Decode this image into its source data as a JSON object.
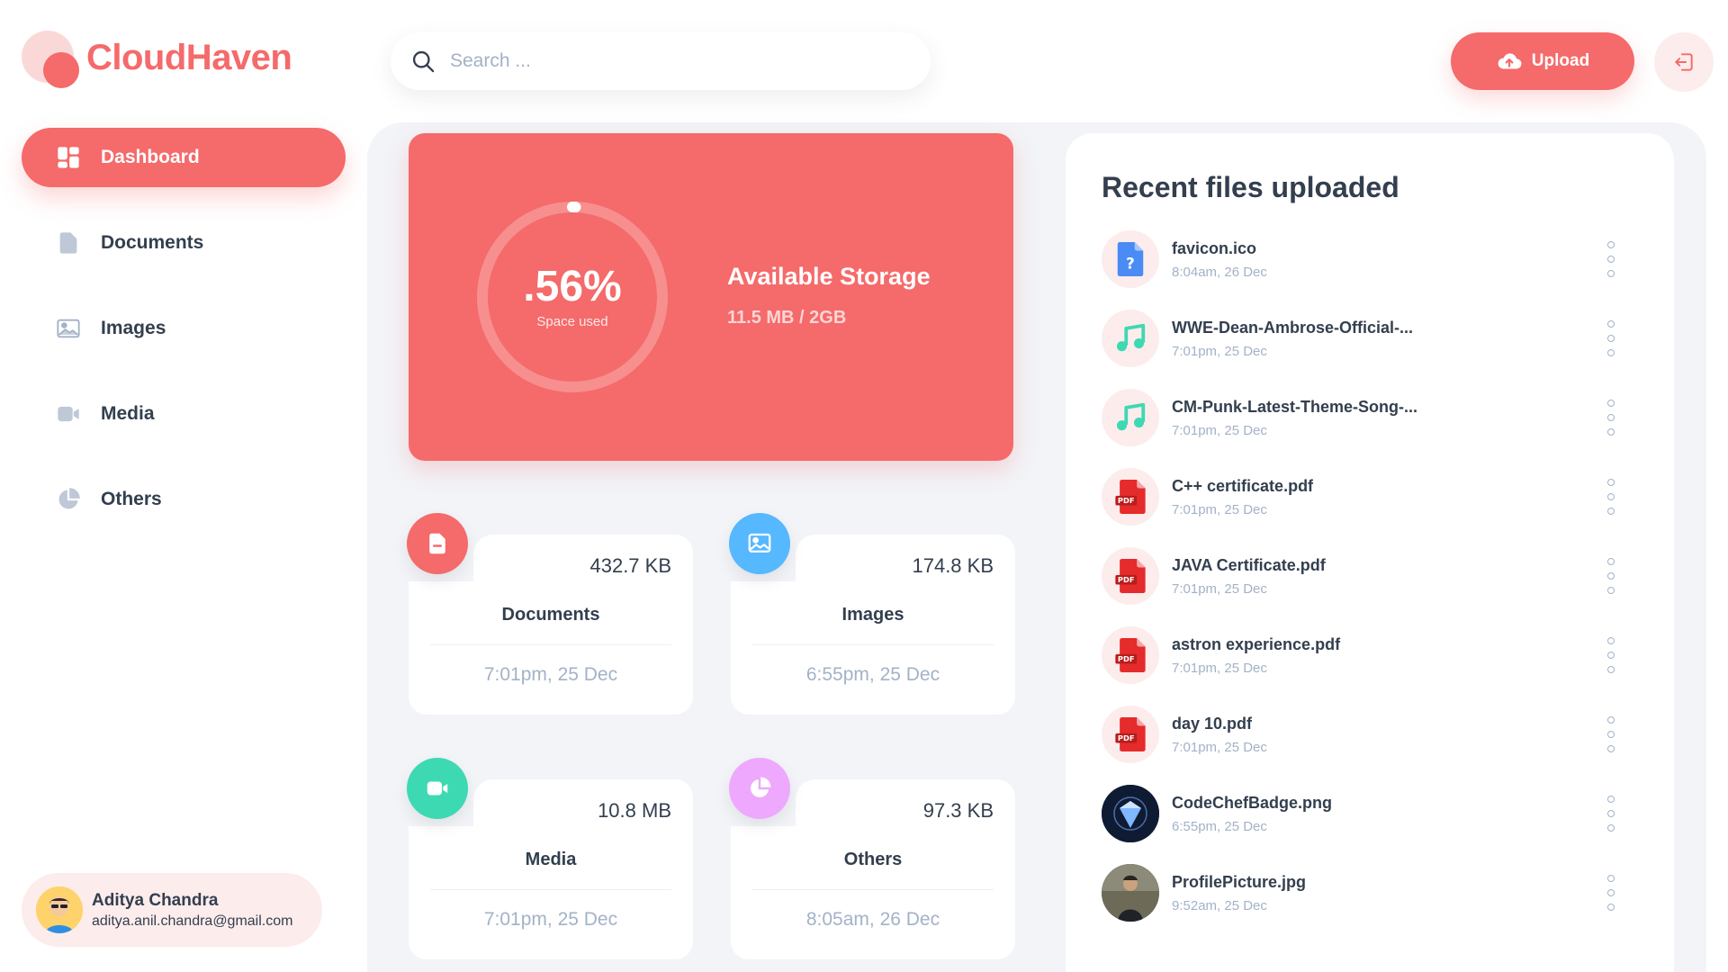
{
  "app": {
    "name": "CloudHaven"
  },
  "search": {
    "placeholder": "Search ..."
  },
  "header": {
    "upload_label": "Upload"
  },
  "sidebar": {
    "items": [
      {
        "label": "Dashboard",
        "icon": "dashboard-icon",
        "active": true
      },
      {
        "label": "Documents",
        "icon": "document-icon",
        "active": false
      },
      {
        "label": "Images",
        "icon": "image-icon",
        "active": false
      },
      {
        "label": "Media",
        "icon": "video-icon",
        "active": false
      },
      {
        "label": "Others",
        "icon": "pie-icon",
        "active": false
      }
    ]
  },
  "user": {
    "name": "Aditya Chandra",
    "email": "aditya.anil.chandra@gmail.com"
  },
  "storage": {
    "percent_label": ".56%",
    "percent_value": 0.56,
    "caption": "Space used",
    "title": "Available Storage",
    "usage": "11.5 MB / 2GB"
  },
  "categories": [
    {
      "title": "Documents",
      "size": "432.7 KB",
      "date": "7:01pm, 25 Dec",
      "color": "#F56A6A",
      "icon": "document-icon"
    },
    {
      "title": "Images",
      "size": "174.8 KB",
      "date": "6:55pm, 25 Dec",
      "color": "#56B8FF",
      "icon": "image-icon"
    },
    {
      "title": "Media",
      "size": "10.8 MB",
      "date": "7:01pm, 25 Dec",
      "color": "#3DD9B3",
      "icon": "video-icon"
    },
    {
      "title": "Others",
      "size": "97.3 KB",
      "date": "8:05am, 26 Dec",
      "color": "#EEA8FD",
      "icon": "pie-icon"
    }
  ],
  "recent": {
    "title": "Recent files uploaded",
    "files": [
      {
        "name": "favicon.ico",
        "date": "8:04am, 26 Dec",
        "icon": "unknown-file-icon"
      },
      {
        "name": "WWE-Dean-Ambrose-Official-...",
        "date": "7:01pm, 25 Dec",
        "icon": "music-icon"
      },
      {
        "name": "CM-Punk-Latest-Theme-Song-...",
        "date": "7:01pm, 25 Dec",
        "icon": "music-icon"
      },
      {
        "name": "C++ certificate.pdf",
        "date": "7:01pm, 25 Dec",
        "icon": "pdf-icon"
      },
      {
        "name": "JAVA Certificate.pdf",
        "date": "7:01pm, 25 Dec",
        "icon": "pdf-icon"
      },
      {
        "name": "astron experience.pdf",
        "date": "7:01pm, 25 Dec",
        "icon": "pdf-icon"
      },
      {
        "name": "day 10.pdf",
        "date": "7:01pm, 25 Dec",
        "icon": "pdf-icon"
      },
      {
        "name": "CodeChefBadge.png",
        "date": "6:55pm, 25 Dec",
        "icon": "badge-thumbnail-icon"
      },
      {
        "name": "ProfilePicture.jpg",
        "date": "9:52am, 25 Dec",
        "icon": "photo-thumbnail-icon"
      }
    ],
    "pdf_badge": "PDF"
  },
  "colors": {
    "brand": "#F56A6A",
    "text": "#333F4E",
    "muted": "#A3B2C7",
    "panel": "#F2F4F8"
  }
}
